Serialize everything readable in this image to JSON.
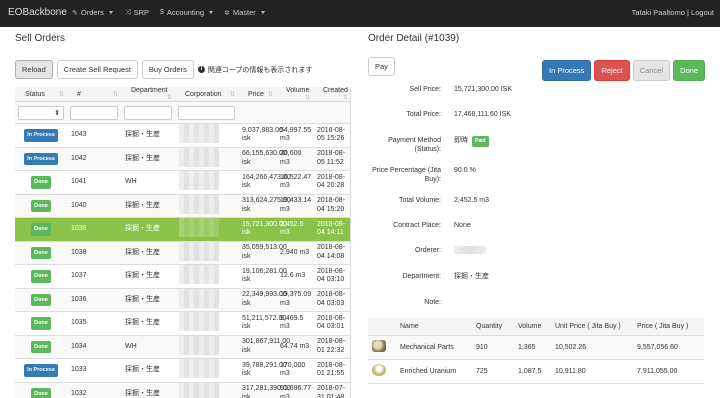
{
  "navbar": {
    "brand": "EOBackbone",
    "items": [
      {
        "label": "Orders",
        "icon": "edit-icon",
        "glyph": "✎",
        "dropdown": true
      },
      {
        "label": "SRP",
        "icon": "shuffle-icon",
        "glyph": "⤨",
        "dropdown": false
      },
      {
        "label": "Accounting",
        "icon": "dollar-icon",
        "glyph": "$",
        "dropdown": true
      },
      {
        "label": "Master",
        "icon": "gear-icon",
        "glyph": "✲",
        "dropdown": true
      }
    ],
    "user": "Tataki Paaltomo | Logout"
  },
  "left": {
    "title": "Sell Orders",
    "buttons": {
      "reload": "Reload",
      "create": "Create Sell Request",
      "buy": "Buy Orders"
    },
    "note": "関連コープの情報も表示されます",
    "columns": [
      "Status",
      "#",
      "Department",
      "Corporation",
      "Price",
      "Volume",
      "Created"
    ],
    "rows": [
      {
        "status": "In Process",
        "id": "1043",
        "dept": "採掘・生産",
        "price": "9,037,883.00 isk",
        "volume": "54,997.55 m3",
        "created": "2018-08-05 15:26"
      },
      {
        "status": "In Process",
        "id": "1042",
        "dept": "採掘・生産",
        "price": "66,155,630.00 isk",
        "volume": "20,600 m3",
        "created": "2018-08-05 11:52"
      },
      {
        "status": "Done",
        "id": "1041",
        "dept": "WH",
        "price": "164,266,473.00 isk",
        "volume": "16,522.47 m3",
        "created": "2018-08-04 20:28"
      },
      {
        "status": "Done",
        "id": "1040",
        "dept": "採掘・生産",
        "price": "313,624,275.00 isk",
        "volume": "19,433.14 m3",
        "created": "2018-08-04 15:20"
      },
      {
        "status": "Done",
        "id": "1039",
        "dept": "採掘・生産",
        "price": "15,721,300.00 isk",
        "volume": "2,452.5 m3",
        "created": "2018-08-04 14:11",
        "selected": true
      },
      {
        "status": "Done",
        "id": "1038",
        "dept": "採掘・生産",
        "price": "35,059,513.00 isk",
        "volume": "2,940 m3",
        "created": "2018-08-04 14:08"
      },
      {
        "status": "Done",
        "id": "1037",
        "dept": "採掘・生産",
        "price": "19,106,281.00 isk",
        "volume": "12.6 m3",
        "created": "2018-08-04 03:10"
      },
      {
        "status": "Done",
        "id": "1036",
        "dept": "採掘・生産",
        "price": "22,349,993.00 isk",
        "volume": "19,375.09 m3",
        "created": "2018-08-04 03:03"
      },
      {
        "status": "Done",
        "id": "1035",
        "dept": "採掘・生産",
        "price": "51,211,572.00 isk",
        "volume": "9,469.5 m3",
        "created": "2018-08-04 03:01"
      },
      {
        "status": "Done",
        "id": "1034",
        "dept": "WH",
        "price": "301,867,911.00 isk",
        "volume": "64.74 m3",
        "created": "2018-08-01 22:32"
      },
      {
        "status": "In Process",
        "id": "1033",
        "dept": "採掘・生産",
        "price": "39,788,291.00 isk",
        "volume": "170,000 m3",
        "created": "2018-08-01 21:55"
      },
      {
        "status": "Done",
        "id": "1032",
        "dept": "採掘・生産",
        "price": "317,281,390.00 isk",
        "volume": "51,696.77 m3",
        "created": "2018-07-31 01:48"
      }
    ]
  },
  "right": {
    "title": "Order Detail (#1039)",
    "pay": "Pay",
    "actions": {
      "in_process": "In Process",
      "reject": "Reject",
      "cancel": "Cancel",
      "done": "Done"
    },
    "fields": {
      "sell_price": {
        "label": "Sell Price:",
        "value": "15,721,300.00 ISK"
      },
      "total_price": {
        "label": "Total Price:",
        "value": "17,468,111.60 ISK"
      },
      "payment": {
        "label1": "Payment Method",
        "label2": "(Status):",
        "value": "即時",
        "badge": "Paid"
      },
      "percentage": {
        "label1": "Price Percentage (Jita",
        "label2": "Buy):",
        "value": "90.0 %"
      },
      "total_volume": {
        "label": "Total Volume:",
        "value": "2,452.5 m3"
      },
      "contract_place": {
        "label": "Contract Place:",
        "value": "None"
      },
      "orderer": {
        "label": "Orderer:"
      },
      "department": {
        "label": "Department:",
        "value": "採掘・生産"
      },
      "note": {
        "label": "Note:"
      }
    },
    "items_columns": [
      "Name",
      "Quantity",
      "Volume",
      "Unit Price ( Jita Buy )",
      "Price ( Jita Buy )"
    ],
    "items": [
      {
        "icon": "mechanical-parts-icon",
        "name": "Mechanical Parts",
        "quantity": "910",
        "volume": "1,365",
        "unit_price": "10,502.26",
        "price": "9,557,056.60"
      },
      {
        "icon": "enriched-uranium-icon",
        "name": "Enriched Uranium",
        "quantity": "725",
        "volume": "1,087.5",
        "unit_price": "10,911.80",
        "price": "7,911,055.00"
      }
    ]
  },
  "colors": {
    "navbar": "#222222",
    "primary": "#337ab7",
    "danger": "#d9534f",
    "success": "#5cb85c",
    "selected_row": "#8bc34a"
  }
}
